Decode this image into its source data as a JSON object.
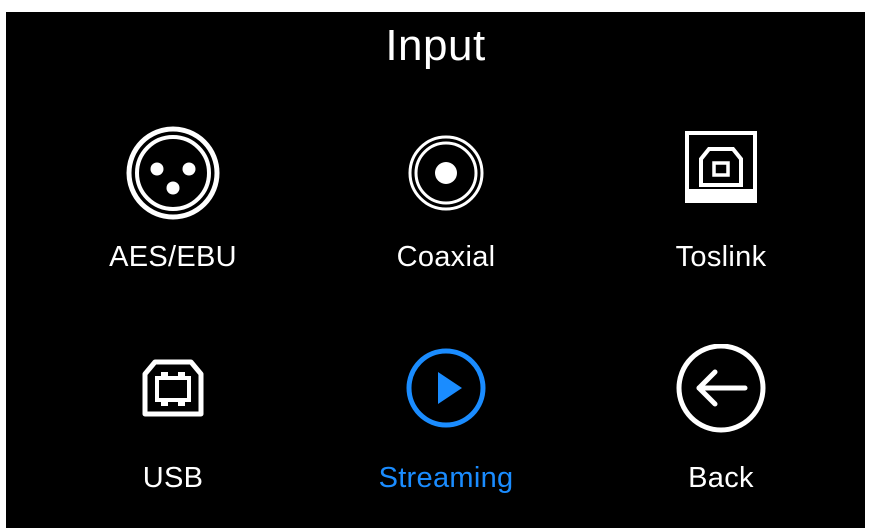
{
  "screen": {
    "title": "Input",
    "accent_color": "#1a8cff",
    "text_color": "#ffffff",
    "background_color": "#000000"
  },
  "inputs": [
    {
      "label": "AES/EBU",
      "icon": "xlr-connector-icon",
      "selected": false
    },
    {
      "label": "Coaxial",
      "icon": "rca-coaxial-icon",
      "selected": false
    },
    {
      "label": "Toslink",
      "icon": "optical-toslink-icon",
      "selected": false
    },
    {
      "label": "USB",
      "icon": "usb-b-icon",
      "selected": false
    },
    {
      "label": "Streaming",
      "icon": "play-circle-icon",
      "selected": true
    },
    {
      "label": "Back",
      "icon": "back-arrow-icon",
      "selected": false
    }
  ]
}
